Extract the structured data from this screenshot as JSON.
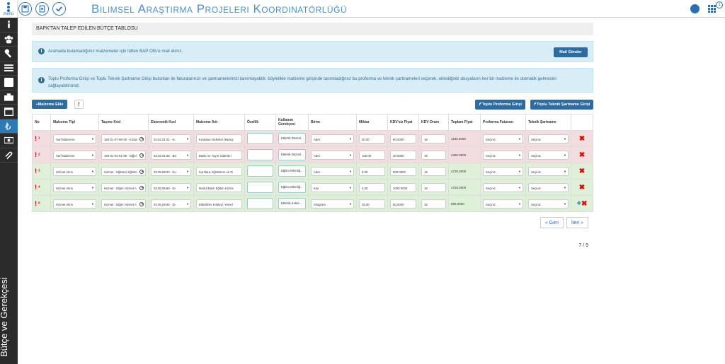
{
  "nav": {
    "menu_label": "menü",
    "items": [
      "info-icon",
      "users-icon",
      "wrench-icon",
      "list-icon",
      "briefcase-icon",
      "calendar-icon",
      "money-icon",
      "cash-icon",
      "paperclip-icon"
    ],
    "active_index": 6,
    "vertical_label": "Bütçe ve Gerekçesi"
  },
  "header": {
    "title": "Bilimsel Araştırma Projeleri Koordinatörlüğü",
    "notif_count": "1"
  },
  "page_title": "BAPK'TAN TALEP EDİLEN BÜTÇE TABLOSU",
  "alerts": {
    "mail_text": "Aramada bulamadığınız malzemeler için lütfen BAP Ofis'e mail atınız.",
    "mail_button": "Mail Gönder",
    "info_text": "Toplu Proforma Girişi ve Toplu Teknik Şartname Girişi butonları ile faturalarınızı ve şartnamelerinizi tanımlayabilir, böylelikle malzeme girişinde tanımladığınız bu proforma ve teknik şartnameleri seçerek, eklediğiniz dosyaların her bir malzeme ile otomatik gelmesini sağlayabilirsiniz."
  },
  "toolbar": {
    "add_label": "+Malzeme Ekle",
    "excl_label": "!",
    "proforma_label": "↱Toplu Proforma Girişi",
    "teknik_label": "↱Toplu Teknik Şartname Girişi"
  },
  "table": {
    "headers": [
      "No",
      "Malzeme Tipi",
      "Taşınır Kod",
      "Ekonomik Kod",
      "Malzeme Adı",
      "Özellik",
      "Kullanım Gerekçesi",
      "Birim",
      "Miktar",
      "KDV'siz Fiyat",
      "KDV Oranı",
      "Toplam Fiyat",
      "Proforma Faturası",
      "Teknik Şartname",
      ""
    ],
    "rows": [
      {
        "no": "1",
        "tip": "Sarf Malzeme",
        "tasinir": "150-01-07-99-30 - Kırtas",
        "eko": "03.02.01.01 - Kı",
        "ad": "Kırtasiye Giderleri (kartuş",
        "ozellik": "",
        "gerekce": "Etkinlik Düzenl...",
        "birim": "Adet",
        "miktar": "20.00",
        "fiyat": "50.0000",
        "kdv": "18",
        "toplam": "1180.0000",
        "proforma": "Seçiniz",
        "teknik": "Seçiniz",
        "status": "red"
      },
      {
        "no": "2",
        "tip": "Sarf Malzeme",
        "tasinir": "150-01-03-01-99 - Diğer",
        "eko": "03.02.01.05 - Ba",
        "ad": "Baskı ve Yayın Giderleri",
        "ozellik": "",
        "gerekce": "Etkinlik Düzenl...",
        "birim": "Adet",
        "miktar": "100.00",
        "fiyat": "20.0000",
        "kdv": "18",
        "toplam": "2360.0000",
        "proforma": "Seçiniz",
        "teknik": "Seçiniz",
        "status": "red"
      },
      {
        "no": "3",
        "tip": "Hizmet Alımı",
        "tasinir": "Hizmet - Eğitimci Eğitimi",
        "eko": "03.05.09.03 - Ku",
        "ad": "Kurslara, Eğitimlere ve Pi",
        "ozellik": "",
        "gerekce": "Eğitim Etkinliğ...",
        "birim": "Adet",
        "miktar": "8.00",
        "fiyat": "500.0000",
        "kdv": "18",
        "toplam": "4720.0000",
        "proforma": "Seçiniz",
        "teknik": "Seçiniz",
        "status": "green"
      },
      {
        "no": "4",
        "tip": "Hizmet Alımı",
        "tasinir": "Hizmet - Diğer Hizmet A",
        "eko": "03.05.09.90 - Di",
        "ad": "Modül Bazlı Eğitim Hizme",
        "ozellik": "",
        "gerekce": "Eğitim Etkinliğ...",
        "birim": "Kişi",
        "miktar": "4.00",
        "fiyat": "1000.0000",
        "kdv": "18",
        "toplam": "4720.0000",
        "proforma": "Seçiniz",
        "teknik": "Seçiniz",
        "status": "green"
      },
      {
        "no": "5",
        "tip": "Hizmet Alımı",
        "tasinir": "Hizmet - Diğer Hizmet A",
        "eko": "03.05.09.90 - Di",
        "ad": "Etkinlikler Kokteyl, Yemel",
        "ozellik": "",
        "gerekce": "Etkinlik Kokte...",
        "birim": "Kilogram",
        "miktar": "15.00",
        "fiyat": "50.0000",
        "kdv": "18",
        "toplam": "885.0000",
        "proforma": "Seçiniz",
        "teknik": "Seçiniz",
        "status": "green"
      }
    ]
  },
  "pager": {
    "prev": "« Geri",
    "next": "İleri »",
    "page_info": "7 / 9"
  }
}
